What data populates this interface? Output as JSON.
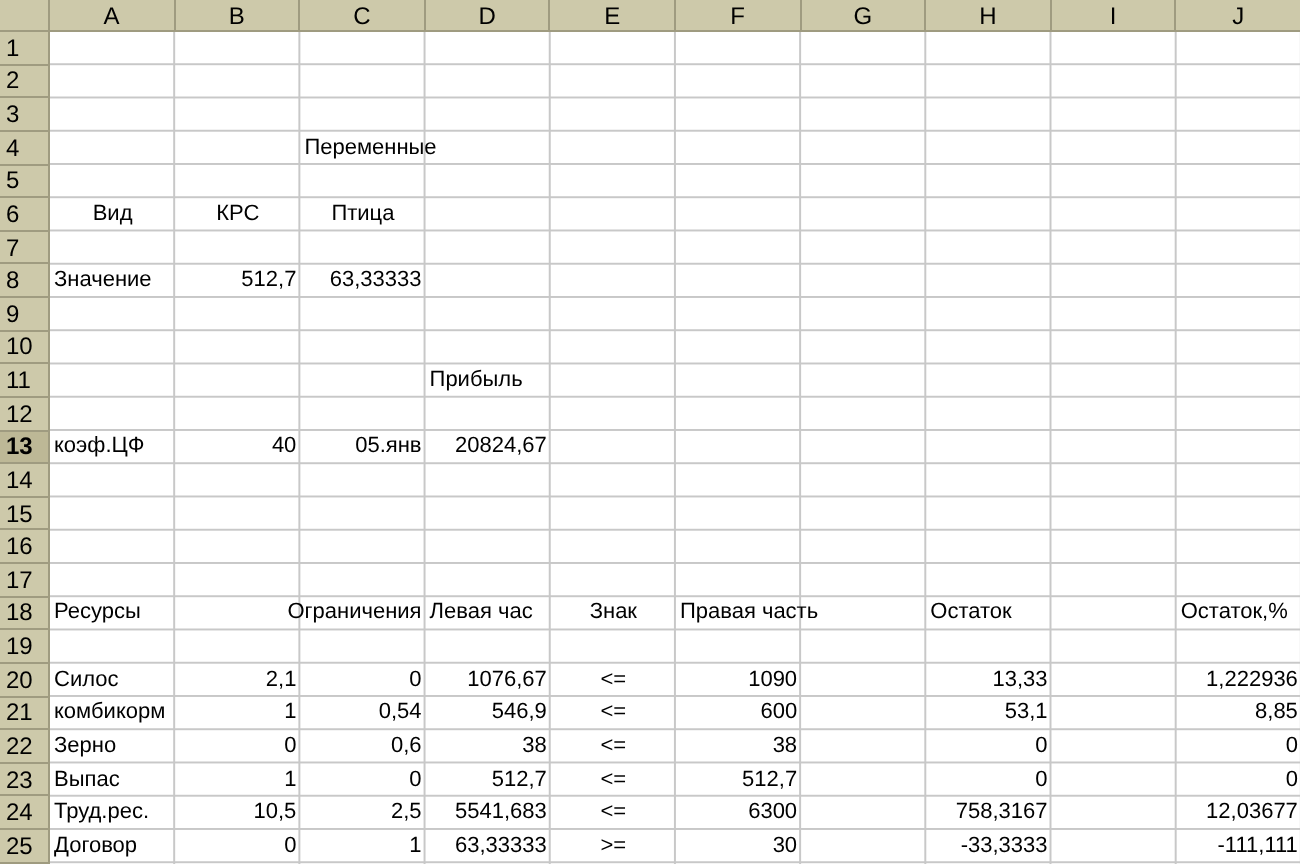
{
  "columns": [
    "A",
    "B",
    "C",
    "D",
    "E",
    "F",
    "G",
    "H",
    "I",
    "J"
  ],
  "rows": [
    {
      "number": "1",
      "selected": false,
      "cells": [
        null,
        null,
        null,
        null,
        null,
        null,
        null,
        null,
        null,
        null
      ]
    },
    {
      "number": "2",
      "selected": false,
      "cells": [
        null,
        null,
        null,
        null,
        null,
        null,
        null,
        null,
        null,
        null
      ]
    },
    {
      "number": "3",
      "selected": false,
      "cells": [
        null,
        null,
        null,
        null,
        null,
        null,
        null,
        null,
        null,
        null
      ]
    },
    {
      "number": "4",
      "selected": false,
      "cells": [
        null,
        null,
        {
          "text": "Переменные",
          "kind": "text"
        },
        null,
        null,
        null,
        null,
        null,
        null,
        null
      ]
    },
    {
      "number": "5",
      "selected": false,
      "cells": [
        null,
        null,
        null,
        null,
        null,
        null,
        null,
        null,
        null,
        null
      ]
    },
    {
      "number": "6",
      "selected": false,
      "cells": [
        {
          "text": "Вид",
          "kind": "centered"
        },
        {
          "text": "КРС",
          "kind": "centered"
        },
        {
          "text": "Птица",
          "kind": "centered"
        },
        null,
        null,
        null,
        null,
        null,
        null,
        null
      ]
    },
    {
      "number": "7",
      "selected": false,
      "cells": [
        null,
        null,
        null,
        null,
        null,
        null,
        null,
        null,
        null,
        null
      ]
    },
    {
      "number": "8",
      "selected": false,
      "cells": [
        {
          "text": "Значение",
          "kind": "text"
        },
        {
          "text": "512,7",
          "kind": "number"
        },
        {
          "text": "63,33333",
          "kind": "number"
        },
        null,
        null,
        null,
        null,
        null,
        null,
        null
      ]
    },
    {
      "number": "9",
      "selected": false,
      "cells": [
        null,
        null,
        null,
        null,
        null,
        null,
        null,
        null,
        null,
        null
      ]
    },
    {
      "number": "10",
      "selected": false,
      "cells": [
        null,
        null,
        null,
        null,
        null,
        null,
        null,
        null,
        null,
        null
      ]
    },
    {
      "number": "11",
      "selected": false,
      "cells": [
        null,
        null,
        null,
        {
          "text": "Прибыль",
          "kind": "text"
        },
        null,
        null,
        null,
        null,
        null,
        null
      ]
    },
    {
      "number": "12",
      "selected": false,
      "cells": [
        null,
        null,
        null,
        null,
        null,
        null,
        null,
        null,
        null,
        null
      ]
    },
    {
      "number": "13",
      "selected": true,
      "cells": [
        {
          "text": "коэф.ЦФ",
          "kind": "text"
        },
        {
          "text": "40",
          "kind": "number"
        },
        {
          "text": "05.янв",
          "kind": "number"
        },
        {
          "text": "20824,67",
          "kind": "number"
        },
        null,
        null,
        null,
        null,
        null,
        null
      ]
    },
    {
      "number": "14",
      "selected": false,
      "cells": [
        null,
        null,
        null,
        null,
        null,
        null,
        null,
        null,
        null,
        null
      ]
    },
    {
      "number": "15",
      "selected": false,
      "cells": [
        null,
        null,
        null,
        null,
        null,
        null,
        null,
        null,
        null,
        null
      ]
    },
    {
      "number": "16",
      "selected": false,
      "cells": [
        null,
        null,
        null,
        null,
        null,
        null,
        null,
        null,
        null,
        null
      ]
    },
    {
      "number": "17",
      "selected": false,
      "cells": [
        null,
        null,
        null,
        null,
        null,
        null,
        null,
        null,
        null,
        null
      ]
    },
    {
      "number": "18",
      "selected": false,
      "cells": [
        {
          "text": "Ресурсы",
          "kind": "text"
        },
        null,
        {
          "text": "Ограничения",
          "kind": "trailing"
        },
        {
          "text": "Левая час",
          "kind": "text"
        },
        {
          "text": "Знак",
          "kind": "centered"
        },
        {
          "text": "Правая часть",
          "kind": "text"
        },
        null,
        {
          "text": "Остаток",
          "kind": "text"
        },
        null,
        {
          "text": "Остаток,%",
          "kind": "text"
        }
      ]
    },
    {
      "number": "19",
      "selected": false,
      "cells": [
        null,
        null,
        null,
        null,
        null,
        null,
        null,
        null,
        null,
        null
      ]
    },
    {
      "number": "20",
      "selected": false,
      "cells": [
        {
          "text": "Силос",
          "kind": "text"
        },
        {
          "text": "2,1",
          "kind": "number"
        },
        {
          "text": "0",
          "kind": "number"
        },
        {
          "text": "1076,67",
          "kind": "number"
        },
        {
          "text": "<=",
          "kind": "centered"
        },
        {
          "text": "1090",
          "kind": "number"
        },
        null,
        {
          "text": "13,33",
          "kind": "number"
        },
        null,
        {
          "text": "1,222936",
          "kind": "number"
        }
      ]
    },
    {
      "number": "21",
      "selected": false,
      "cells": [
        {
          "text": "комбикорм",
          "kind": "text"
        },
        {
          "text": "1",
          "kind": "number"
        },
        {
          "text": "0,54",
          "kind": "number"
        },
        {
          "text": "546,9",
          "kind": "number"
        },
        {
          "text": "<=",
          "kind": "centered"
        },
        {
          "text": "600",
          "kind": "number"
        },
        null,
        {
          "text": "53,1",
          "kind": "number"
        },
        null,
        {
          "text": "8,85",
          "kind": "number"
        }
      ]
    },
    {
      "number": "22",
      "selected": false,
      "cells": [
        {
          "text": "Зерно",
          "kind": "text"
        },
        {
          "text": "0",
          "kind": "number"
        },
        {
          "text": "0,6",
          "kind": "number"
        },
        {
          "text": "38",
          "kind": "number"
        },
        {
          "text": "<=",
          "kind": "centered"
        },
        {
          "text": "38",
          "kind": "number"
        },
        null,
        {
          "text": "0",
          "kind": "number"
        },
        null,
        {
          "text": "0",
          "kind": "number"
        }
      ]
    },
    {
      "number": "23",
      "selected": false,
      "cells": [
        {
          "text": "Выпас",
          "kind": "text"
        },
        {
          "text": "1",
          "kind": "number"
        },
        {
          "text": "0",
          "kind": "number"
        },
        {
          "text": "512,7",
          "kind": "number"
        },
        {
          "text": "<=",
          "kind": "centered"
        },
        {
          "text": "512,7",
          "kind": "number"
        },
        null,
        {
          "text": "0",
          "kind": "number"
        },
        null,
        {
          "text": "0",
          "kind": "number"
        }
      ]
    },
    {
      "number": "24",
      "selected": false,
      "cells": [
        {
          "text": "Труд.рес.",
          "kind": "text"
        },
        {
          "text": "10,5",
          "kind": "number"
        },
        {
          "text": "2,5",
          "kind": "number"
        },
        {
          "text": "5541,683",
          "kind": "number"
        },
        {
          "text": "<=",
          "kind": "centered"
        },
        {
          "text": "6300",
          "kind": "number"
        },
        null,
        {
          "text": "758,3167",
          "kind": "number"
        },
        null,
        {
          "text": "12,03677",
          "kind": "number"
        }
      ]
    },
    {
      "number": "25",
      "selected": false,
      "cells": [
        {
          "text": "Договор",
          "kind": "text"
        },
        {
          "text": "0",
          "kind": "number"
        },
        {
          "text": "1",
          "kind": "number"
        },
        {
          "text": "63,33333",
          "kind": "number"
        },
        {
          "text": ">=",
          "kind": "centered"
        },
        {
          "text": "30",
          "kind": "number"
        },
        null,
        {
          "text": "-33,3333",
          "kind": "number"
        },
        null,
        {
          "text": "-111,111",
          "kind": "number"
        }
      ]
    }
  ]
}
